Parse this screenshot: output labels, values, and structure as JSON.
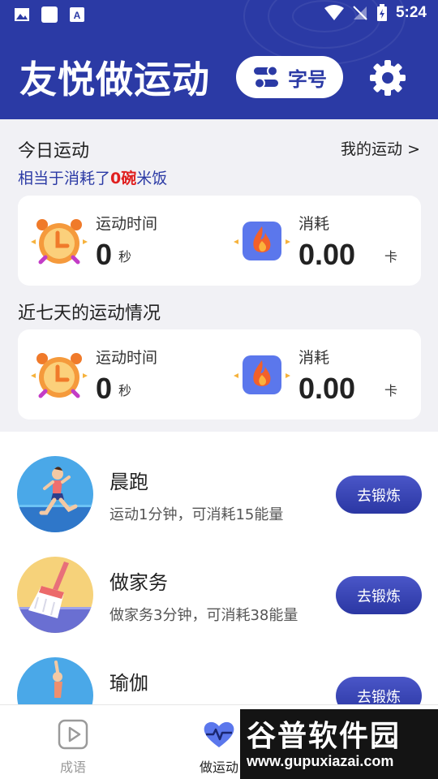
{
  "status_bar": {
    "time": "5:24"
  },
  "header": {
    "app_title": "友悦做运动",
    "font_size_button": "字号",
    "accent_color": "#2b3aa5"
  },
  "today": {
    "title": "今日运动",
    "my_sport_link": "我的运动 >",
    "subline_prefix": "相当于消耗了",
    "subline_value": "0碗",
    "subline_suffix": "米饭",
    "duration_label": "运动时间",
    "duration_value": "0",
    "duration_unit": "秒",
    "calorie_label": "消耗",
    "calorie_value": "0.00",
    "calorie_unit": "卡"
  },
  "week": {
    "title": "近七天的运动情况",
    "duration_label": "运动时间",
    "duration_value": "0",
    "duration_unit": "秒",
    "calorie_label": "消耗",
    "calorie_value": "0.00",
    "calorie_unit": "卡"
  },
  "exercises": [
    {
      "title": "晨跑",
      "desc": "运动1分钟，可消耗15能量",
      "button": "去锻炼",
      "icon": "running-person-icon"
    },
    {
      "title": "做家务",
      "desc": "做家务3分钟，可消耗38能量",
      "button": "去锻炼",
      "icon": "broom-icon"
    },
    {
      "title": "瑜伽",
      "desc": "",
      "button": "去锻炼",
      "icon": "yoga-icon"
    }
  ],
  "nav": {
    "items": [
      {
        "label": "成语",
        "icon": "play-icon",
        "active": false
      },
      {
        "label": "做运动",
        "icon": "heartbeat-icon",
        "active": true
      }
    ]
  },
  "watermark": {
    "text": "谷普软件园",
    "url": "www.gupuxiazai.com"
  }
}
